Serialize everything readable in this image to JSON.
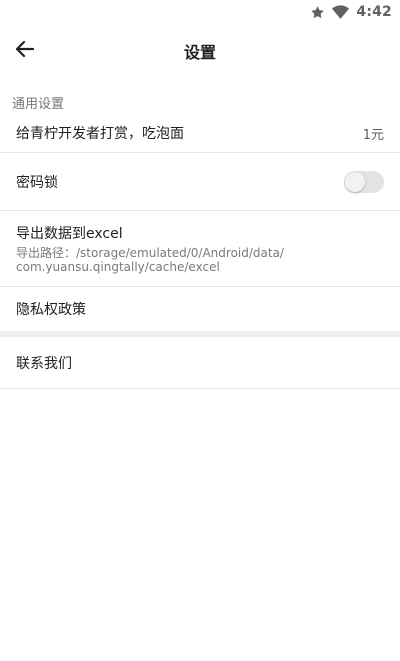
{
  "status_bar": {
    "time": "4:42",
    "icons": [
      "star-icon",
      "wifi-icon"
    ]
  },
  "toolbar": {
    "title": "设置",
    "back_icon": "arrow-left-icon"
  },
  "section": {
    "header": "通用设置"
  },
  "rows": {
    "donate": {
      "label": "给青柠开发者打赏，吃泡面",
      "value": "1元"
    },
    "lock": {
      "label": "密码锁",
      "toggle_on": false
    },
    "export": {
      "label": "导出数据到excel",
      "path_line1": "导出路径：/storage/emulated/0/Android/data/",
      "path_line2": "com.yuansu.qingtally/cache/excel"
    },
    "privacy": {
      "label": "隐私权政策"
    },
    "contact": {
      "label": "联系我们"
    }
  },
  "colors": {
    "divider": "#e6e6e6",
    "gap": "#eeeeee",
    "toggle_off_track": "#e3e3e3",
    "text_primary": "#212121",
    "text_secondary": "#757575"
  }
}
